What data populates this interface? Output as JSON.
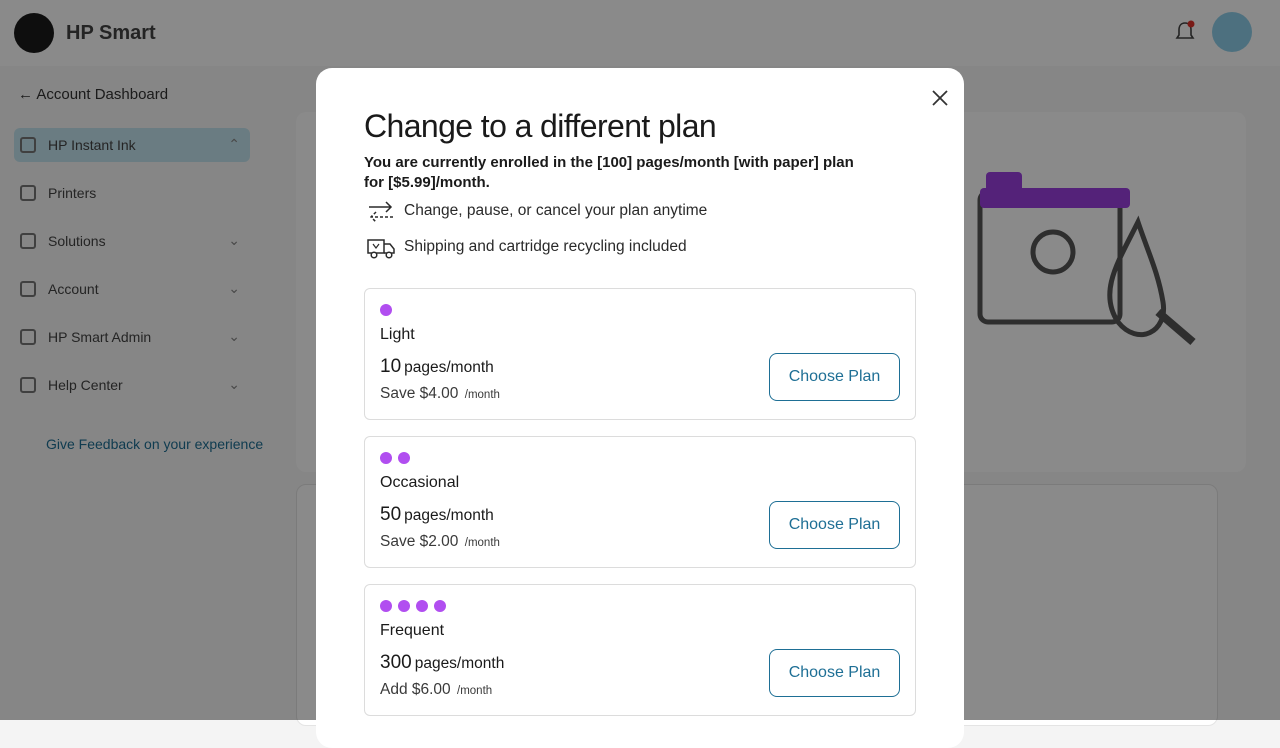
{
  "app": {
    "brand": "HP Smart",
    "back_link": "Account Dashboard",
    "sidebar": [
      {
        "label": "HP Instant Ink",
        "active": true
      },
      {
        "label": "Printers"
      },
      {
        "label": "Solutions"
      },
      {
        "label": "Account"
      },
      {
        "label": "HP Smart Admin"
      },
      {
        "label": "Help Center"
      }
    ],
    "sidebar_link": "Give Feedback on your experience"
  },
  "modal": {
    "title": "Change to a different plan",
    "subtitle": "You are currently enrolled in the [100] pages/month [with paper] plan for [$5.99]/month.",
    "features": [
      {
        "icon": "change-plan-icon",
        "text": "Change, pause, or cancel your plan anytime"
      },
      {
        "icon": "shipping-truck-icon",
        "text": "Shipping and cartridge recycling included"
      }
    ],
    "plans": [
      {
        "name": "Light",
        "dots": 1,
        "pages": "10",
        "pages_unit": "pages/month",
        "price_text": "Save $4.00",
        "per": "/month",
        "button": "Choose Plan"
      },
      {
        "name": "Occasional",
        "dots": 2,
        "pages": "50",
        "pages_unit": "pages/month",
        "price_text": "Save $2.00",
        "per": "/month",
        "button": "Choose Plan"
      },
      {
        "name": "Frequent",
        "dots": 4,
        "pages": "300",
        "pages_unit": "pages/month",
        "price_text": "Add $6.00",
        "per": "/month",
        "button": "Choose Plan"
      }
    ]
  },
  "colors": {
    "accent": "#1e6f95",
    "plan_dot": "#b14ef0",
    "overlay": "rgba(0,0,0,0.46)"
  }
}
